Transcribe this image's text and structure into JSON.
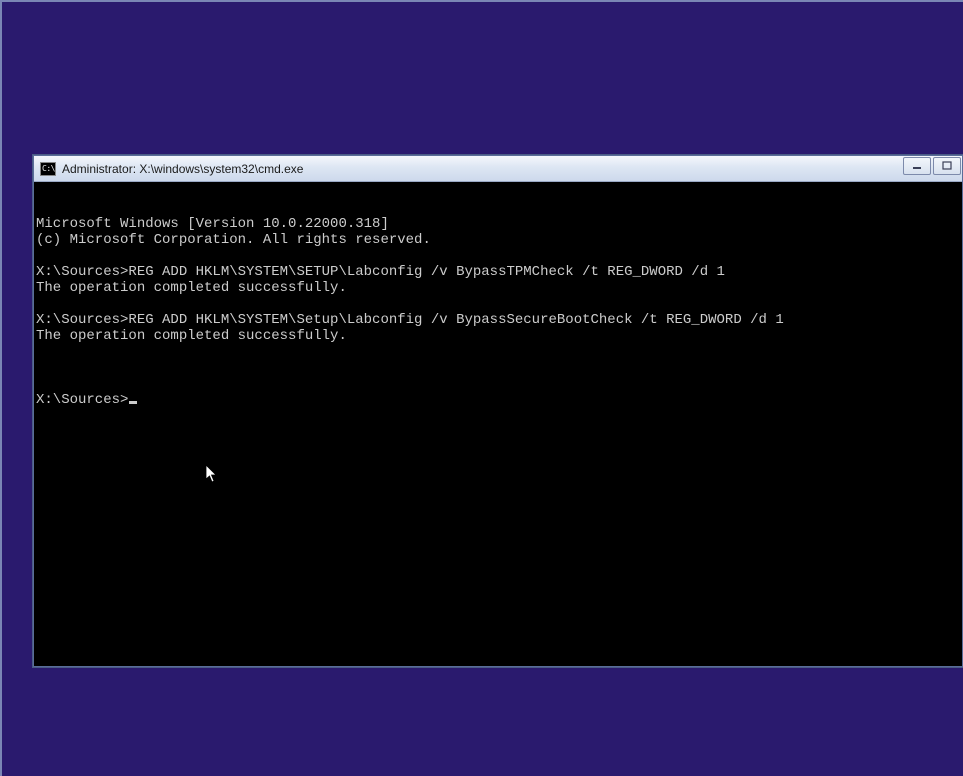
{
  "titlebar": {
    "icon_text": "C:\\",
    "title": "Administrator: X:\\windows\\system32\\cmd.exe"
  },
  "terminal": {
    "lines": [
      "Microsoft Windows [Version 10.0.22000.318]",
      "(c) Microsoft Corporation. All rights reserved.",
      "",
      "X:\\Sources>REG ADD HKLM\\SYSTEM\\SETUP\\Labconfig /v BypassTPMCheck /t REG_DWORD /d 1",
      "The operation completed successfully.",
      "",
      "X:\\Sources>REG ADD HKLM\\SYSTEM\\Setup\\Labconfig /v BypassSecureBootCheck /t REG_DWORD /d 1",
      "The operation completed successfully.",
      ""
    ],
    "prompt": "X:\\Sources>"
  }
}
